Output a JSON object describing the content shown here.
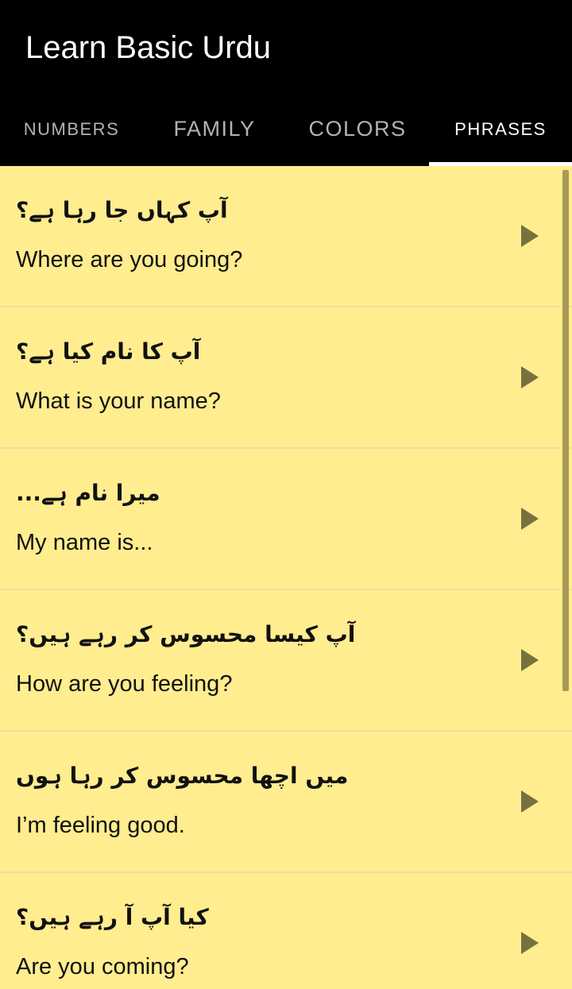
{
  "app_bar": {
    "title": "Learn Basic Urdu",
    "background": "#000000"
  },
  "tabs": [
    {
      "label": "NUMBERS",
      "active": false
    },
    {
      "label": "FAMILY",
      "active": false
    },
    {
      "label": "COLORS",
      "active": false
    },
    {
      "label": "PHRASES",
      "active": true
    }
  ],
  "phrases": [
    {
      "urdu": "آپ کہاں جا رہا ہے؟",
      "english": "Where are you going?",
      "icon": "play-icon"
    },
    {
      "urdu": "آپ کا نام کیا ہے؟",
      "english": "What is your name?",
      "icon": "play-icon"
    },
    {
      "urdu": "میرا نام ہے...",
      "english": "My name is...",
      "icon": "play-icon"
    },
    {
      "urdu": "آپ کیسا محسوس کر رہے ہیں؟",
      "english": "How are you feeling?",
      "icon": "play-icon"
    },
    {
      "urdu": "میں اچھا محسوس کر رہا ہوں",
      "english": "I’m feeling good.",
      "icon": "play-icon"
    },
    {
      "urdu": "کیا آپ آ رہے ہیں؟",
      "english": "Are you coming?",
      "icon": "play-icon"
    }
  ],
  "colors": {
    "list_background": "#FFED8F",
    "play_icon": "#77713D",
    "active_tab_indicator": "#FFFFFF"
  }
}
